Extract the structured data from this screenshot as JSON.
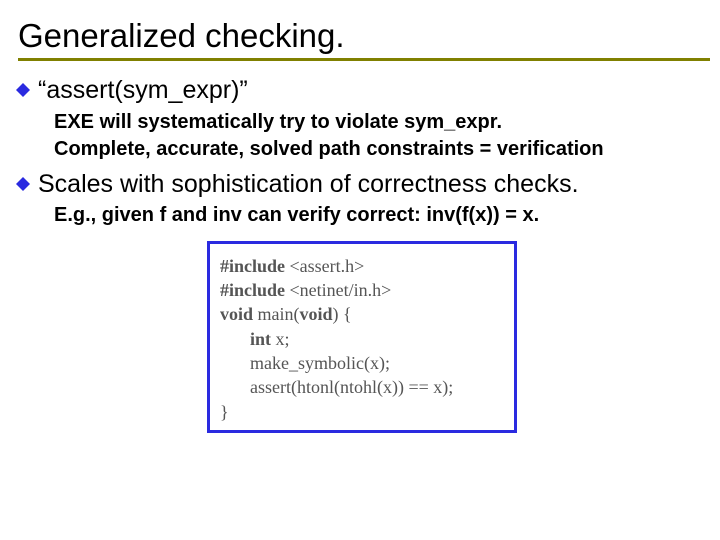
{
  "title": "Generalized checking.",
  "bullets": [
    {
      "text": "“assert(sym_expr)”",
      "subs": [
        "EXE will systematically try to violate sym_expr.",
        "Complete, accurate, solved path constraints = verification"
      ]
    },
    {
      "text": "Scales with sophistication of correctness checks.",
      "subs": [
        "E.g., given f and inv can verify correct: inv(f(x)) = x."
      ]
    }
  ],
  "code": {
    "include1_pre": "#include",
    "include1_hdr": "<assert.h>",
    "include2_pre": "#include",
    "include2_hdr": "<netinet/in.h>",
    "void1": "void",
    "main_mid": " main(",
    "void2": "void",
    "main_end": ") {",
    "int_kw": "int",
    "int_rest": " x;",
    "line_make": "make_symbolic(x);",
    "line_assert": "assert(htonl(ntohl(x)) == x);",
    "close": "}"
  }
}
